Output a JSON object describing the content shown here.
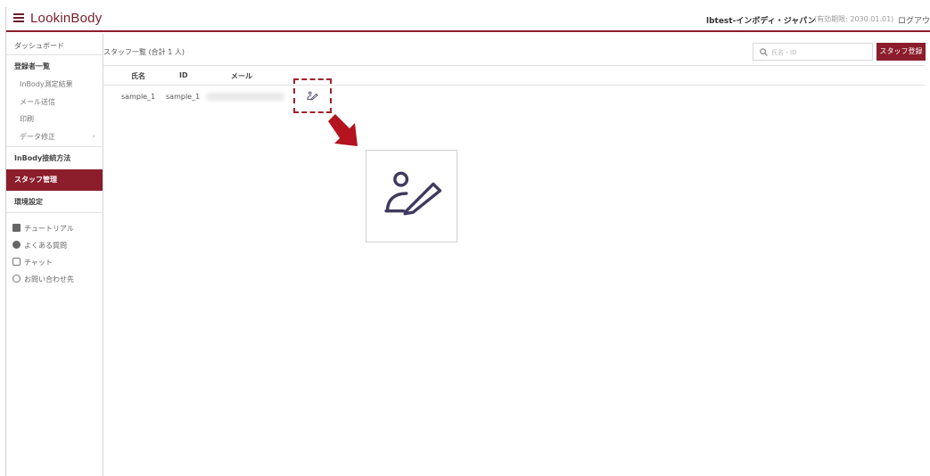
{
  "header": {
    "logo": "LookinBody",
    "user": "lbtest-インボディ・ジャパン",
    "expiry": "(有効期限: 2030.01.01)",
    "logout": "ログアウト"
  },
  "sidebar": {
    "items": [
      {
        "label": "ダッシュボード"
      },
      {
        "label": "登録者一覧"
      },
      {
        "label": "InBody測定結果"
      },
      {
        "label": "メール送信"
      },
      {
        "label": "印刷"
      },
      {
        "label": "データ修正",
        "chevron": "›"
      },
      {
        "label": "InBody接続方法"
      },
      {
        "label": "スタッフ管理"
      },
      {
        "label": "環境設定"
      }
    ],
    "help": [
      {
        "label": "チュートリアル",
        "icon": "tutorial-icon"
      },
      {
        "label": "よくある質問",
        "icon": "faq-icon"
      },
      {
        "label": "チャット",
        "icon": "chat-icon"
      },
      {
        "label": "お問い合わせ先",
        "icon": "contact-icon"
      }
    ]
  },
  "main": {
    "title": "スタッフ一覧 (合計 1 人)",
    "search_placeholder": "氏名・ID",
    "register_button": "スタッフ登録",
    "columns": [
      "氏名",
      "ID",
      "メール"
    ],
    "rows": [
      {
        "name": "sample_1",
        "id": "sample_1",
        "email": ""
      }
    ]
  },
  "colors": {
    "brand": "#8c1d2b",
    "icon": "#3f3a5e"
  }
}
